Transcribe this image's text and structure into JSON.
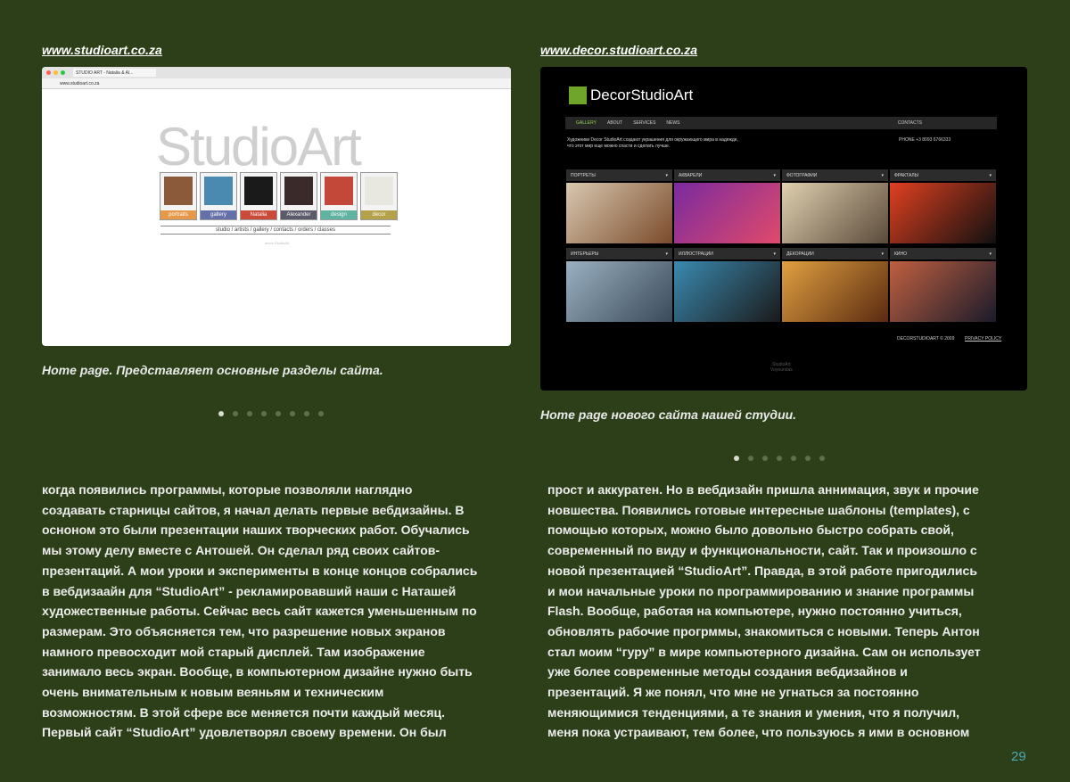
{
  "left": {
    "url": "www.studioart.co.za",
    "caption": "Home page. Представляет основные разделы сайта.",
    "slide_count": 8,
    "active_slide": 0,
    "screenshot": {
      "tab_title": "STUDIO ART - Natalia & Al...",
      "address": "www.studioart.co.za",
      "logo": "StudioArt",
      "thumbs": [
        {
          "label": "portraits",
          "color": "#e6994a"
        },
        {
          "label": "gallery",
          "color": "#6670a8"
        },
        {
          "label": "Natalia",
          "color": "#cc4a3a"
        },
        {
          "label": "Alexander",
          "color": "#5a5a6a"
        },
        {
          "label": "design",
          "color": "#5fb3a0"
        },
        {
          "label": "decor",
          "color": "#b3a24a"
        }
      ],
      "nav": "studio / artists / gallery / contacts / orders / classes",
      "footer": "decor.StudioArt"
    }
  },
  "right": {
    "url": "www.decor.studioart.co.za",
    "caption": "Home page нового сайта нашей студии.",
    "slide_count": 7,
    "active_slide": 0,
    "screenshot": {
      "logo": "DecorStudioArt",
      "nav": [
        "GALLERY",
        "ABOUT",
        "SERVICES",
        "NEWS",
        "CONTACTS"
      ],
      "intro": "Художники Decor StudioArt создают украшения для окружающего мира в надежде,\nчто этот мир еще можно спасти и сделать лучше.",
      "phone": "PHONE   +3 8093 6766333",
      "categories_row1": [
        "ПОРТРЕТЫ",
        "АКВАРЕЛИ",
        "ФОТОГРАФИИ",
        "ФРАКТАЛЫ"
      ],
      "categories_row2": [
        "ИНТЕРЬЕРЫ",
        "ИЛЛЮСТРАЦИИ",
        "ДЕКОРАЦИИ",
        "КИНО"
      ],
      "footer": "DECORSTUDIOART  © 2009",
      "privacy": "PRIVACY POLICY",
      "tiny_links": "StudioArt\nVoyeurstas"
    }
  },
  "text_left": "когда появились программы, которые позволяли наглядно\nсоздавать старницы сайтов, я начал делать первые вебдизайны. В\nосноном это были презентации наших творческих работ. Обучались\nмы этому делу вместе с Антошей. Он сделал ряд своих сайтов-\nпрезентаций. А мои уроки и эксперименты в конце концов собрались\nв вебдизаайн для “StudioArt” - рекламировавший наши с Наташей\nхудожественные работы. Сейчас весь сайт кажется уменьшенным по\nразмерам. Это объясняется тем, что разрешение новых экранов\nнамного превосходит мой старый дисплей. Там изображение\nзанимало весь экран. Вообще, в компьютерном дизайне нужно быть\nочень внимательным к новым веяньям и техническим\nвозможностям. В этой сфере все меняется почти каждый месяц.\nПервый сайт “StudioArt” удовлетворял своему времени. Он был",
  "text_right": "прост и аккуратен. Но в вебдизайн пришла аннимация, звук и прочие\nновшества. Появились готовые интересные шаблоны (templates),  с\nпомощью которых, можно было довольно быстро собрать свой,\nсовременный по виду и функциональности, сайт. Так и произошло с\nновой презентацией “StudioArt”. Правда, в этой работе пригодились\nи мои начальные уроки по программированию и знание программы\nFlash. Вообще, работая на компьютере, нужно постоянно учиться,\nобновлять рабочие прогрммы, знакомиться с новыми. Теперь Антон\nстал моим “гуру” в мире компьютерного дизайна. Сам он использует\nуже более современные методы создания вебдизайнов и\nпрезентаций. Я же понял, что мне не угнаться за постоянно\nменяющимися тенденциями, а те знания и умения, что я получил,\nменя пока устраивают, тем более, что пользуюсь я ими в основном",
  "page_number": "29"
}
